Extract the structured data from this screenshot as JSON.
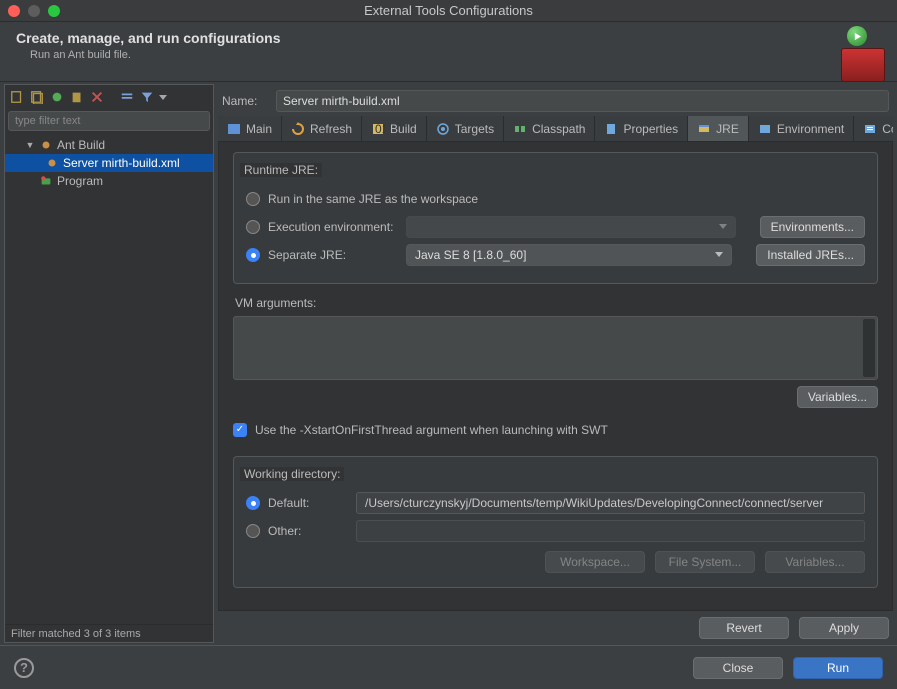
{
  "window": {
    "title": "External Tools Configurations"
  },
  "header": {
    "title": "Create, manage, and run configurations",
    "subtitle": "Run an Ant build file."
  },
  "left": {
    "filter_placeholder": "type filter text",
    "tree": {
      "root": "Ant Build",
      "child": "Server mirth-build.xml",
      "sibling": "Program"
    },
    "status": "Filter matched 3 of 3 items"
  },
  "name": {
    "label": "Name:",
    "value": "Server mirth-build.xml"
  },
  "tabs": {
    "main": "Main",
    "refresh": "Refresh",
    "build": "Build",
    "targets": "Targets",
    "classpath": "Classpath",
    "properties": "Properties",
    "jre": "JRE",
    "environment": "Environment",
    "common": "Common"
  },
  "jre": {
    "group_label": "Runtime JRE:",
    "same_ws": "Run in the same JRE as the workspace",
    "exec_env": "Execution environment:",
    "sep_jre": "Separate JRE:",
    "sep_jre_value": "Java SE 8 [1.8.0_60]",
    "btn_envs": "Environments...",
    "btn_installed": "Installed JREs..."
  },
  "vm": {
    "label": "VM arguments:",
    "btn_vars": "Variables...",
    "swt_check": "Use the -XstartOnFirstThread argument when launching with SWT"
  },
  "wd": {
    "label": "Working directory:",
    "default": "Default:",
    "default_value": "/Users/cturczynskyj/Documents/temp/WikiUpdates/DevelopingConnect/connect/server",
    "other": "Other:",
    "btn_ws": "Workspace...",
    "btn_fs": "File System...",
    "btn_vars": "Variables..."
  },
  "actions": {
    "revert": "Revert",
    "apply": "Apply"
  },
  "footer": {
    "close": "Close",
    "run": "Run"
  }
}
